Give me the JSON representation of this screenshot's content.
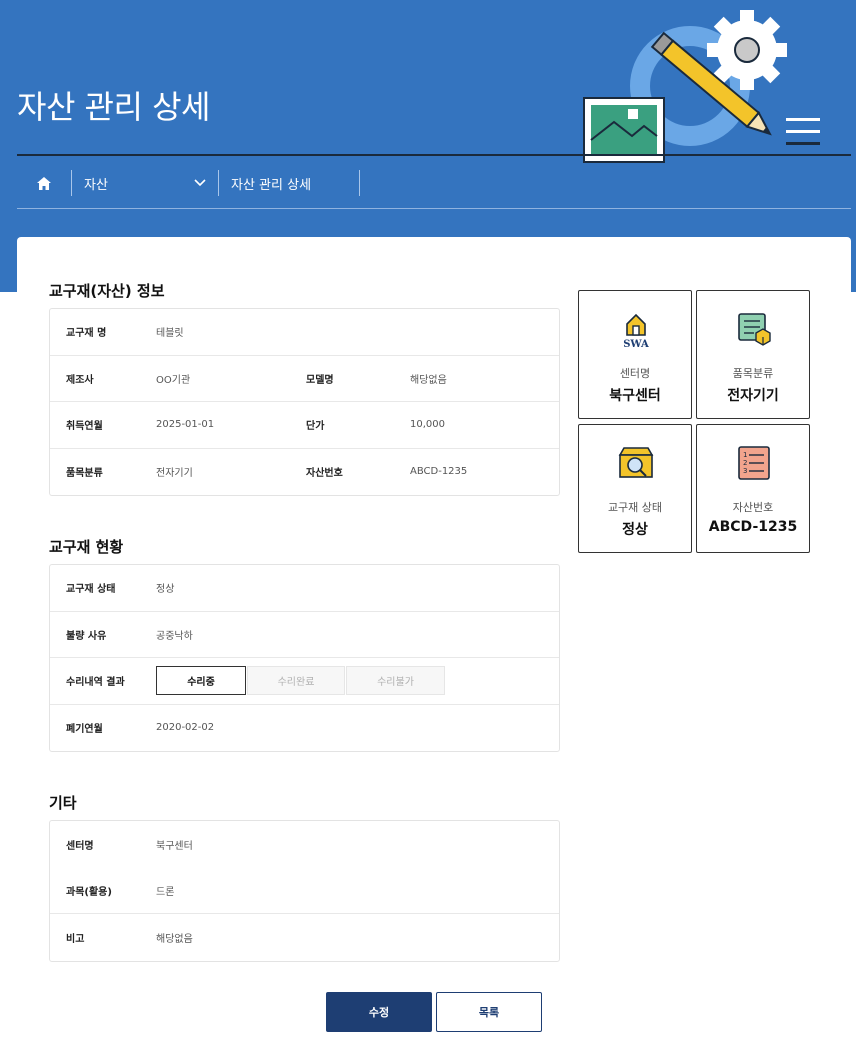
{
  "header": {
    "title": "자산 관리 상세",
    "colors": {
      "background": "#3474bf",
      "primary_button": "#1e3e73"
    }
  },
  "breadcrumb": {
    "home_icon": "home-icon",
    "items": [
      {
        "label": "자산",
        "has_dropdown": true
      },
      {
        "label": "자산 관리 상세"
      }
    ]
  },
  "asset_info": {
    "title": "교구재(자산) 정보",
    "rows": [
      {
        "label": "교구재 명",
        "value": "테블릿"
      },
      {
        "label": "제조사",
        "value": "OO기관",
        "label2": "모델명",
        "value2": "해당없음"
      },
      {
        "label": "취득연월",
        "value": "2025-01-01",
        "label2": "단가",
        "value2": "10,000"
      },
      {
        "label": "품목분류",
        "value": "전자기기",
        "label2": "자산번호",
        "value2": "ABCD-1235"
      }
    ]
  },
  "status": {
    "title": "교구재 현황",
    "rows": [
      {
        "label": "교구재 상태",
        "value": "정상"
      },
      {
        "label": "불량 사유",
        "value": "공중낙하"
      },
      {
        "label": "수리내역 결과",
        "options": [
          "수리중",
          "수리완료",
          "수리불가"
        ],
        "selected": "수리중"
      },
      {
        "label": "폐기연월",
        "value": "2020-02-02"
      }
    ]
  },
  "etc": {
    "title": "기타",
    "rows": [
      {
        "label": "센터명",
        "value": "북구센터"
      },
      {
        "label": "과목(활용)",
        "value": "드론"
      },
      {
        "label": "비고",
        "value": "해당없음"
      }
    ]
  },
  "summary": [
    {
      "icon": "swa-house-icon",
      "logo_text": "SWA",
      "label": "센터명",
      "value": "북구센터"
    },
    {
      "icon": "box-settings-icon",
      "label": "품목분류",
      "value": "전자기기"
    },
    {
      "icon": "box-search-icon",
      "label": "교구재 상태",
      "value": "정상"
    },
    {
      "icon": "numbered-list-icon",
      "label": "자산번호",
      "value": "ABCD-1235"
    }
  ],
  "actions": {
    "edit": "수정",
    "list": "목록"
  }
}
